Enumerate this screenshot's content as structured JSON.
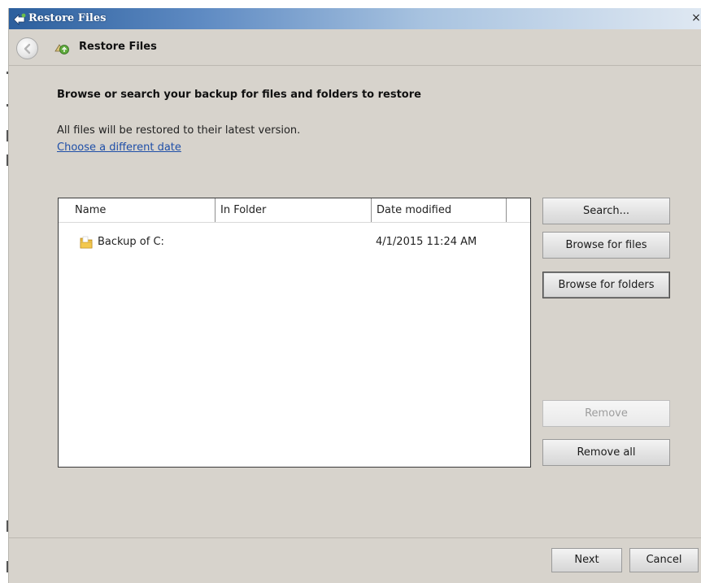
{
  "window": {
    "title": "Restore Files",
    "close_glyph": "×"
  },
  "nav": {
    "title": "Restore Files",
    "icons": [
      "back-arrow-icon",
      "restore-files-icon"
    ]
  },
  "content": {
    "heading": "Browse or search your backup for files and folders to restore",
    "info": "All files will be restored to their latest version.",
    "link": "Choose a different date"
  },
  "list": {
    "columns": [
      "Name",
      "In Folder",
      "Date modified",
      ""
    ],
    "rows": [
      {
        "icon": "folder-icon",
        "name": "Backup of C:",
        "folder": "",
        "date": "4/1/2015 11:24 AM"
      }
    ]
  },
  "actions": {
    "search": "Search...",
    "browse_files": "Browse for files",
    "browse_folders": "Browse for folders",
    "remove": "Remove",
    "remove_all": "Remove all"
  },
  "footer": {
    "next": "Next",
    "cancel": "Cancel"
  },
  "colors": {
    "title_bar": "#2c5f9d",
    "window_bg": "#d7d3cc",
    "link": "#1f4fa8"
  }
}
